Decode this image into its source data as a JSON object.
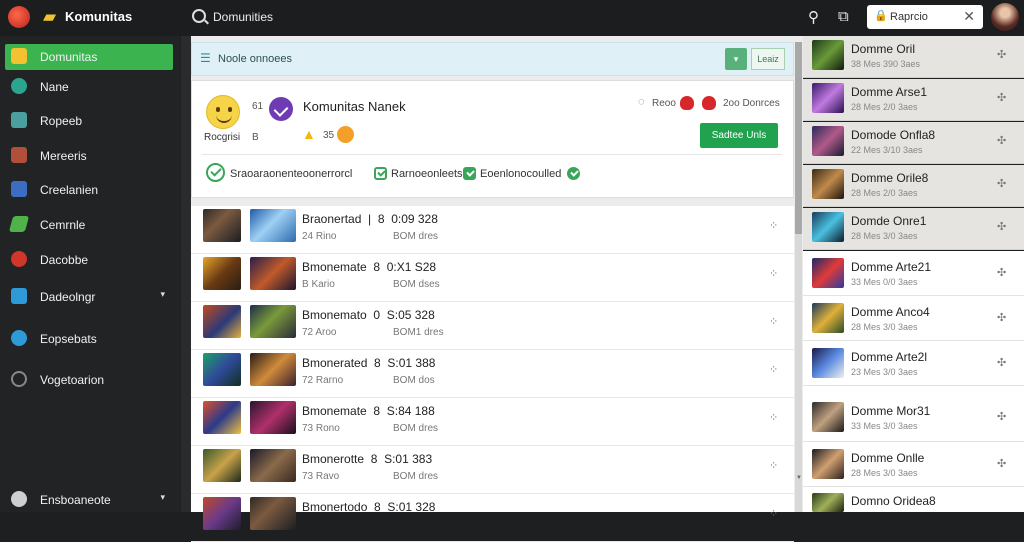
{
  "app": {
    "title": "Komunitas"
  },
  "topbar": {
    "search_text": "Domunities",
    "pill_text": "Raprcio",
    "pill_close": "✕"
  },
  "colors": {
    "accent_green": "#3bb44f",
    "join_green": "#21a24f",
    "info_bg": "#dff1f6",
    "sidebar_bg": "#222325"
  },
  "sidebar": {
    "items": [
      {
        "label": "Domunitas",
        "icon": "folder-icon",
        "active": true
      },
      {
        "label": "Nane",
        "icon": "globe-icon"
      },
      {
        "label": "Ropeeb",
        "icon": "store-icon"
      },
      {
        "label": "Mereeris",
        "icon": "gallery-icon"
      },
      {
        "label": "Creelanien",
        "icon": "puzzle-icon"
      },
      {
        "label": "Cemrnle",
        "icon": "arrow-icon"
      },
      {
        "label": "Dacobbe",
        "icon": "fire-icon"
      },
      {
        "label": "Dadeolngr",
        "icon": "window-icon",
        "chevron": "▾"
      },
      {
        "label": "Eopsebats",
        "icon": "chart-icon"
      },
      {
        "label": "Vogetoarion",
        "icon": "circle-icon"
      },
      {
        "label": "Ensboaneote",
        "icon": "plus-circle-icon",
        "chevron": "▾"
      }
    ]
  },
  "infobar": {
    "label": "Noole onnoees",
    "btn1": "▾",
    "btn2": "Leaiz"
  },
  "card": {
    "smiley_label": "Rocgrisi",
    "small_num": "61",
    "small_b": "B",
    "title": "Komunitas Nanek",
    "reaction_count": "35",
    "stats_emoji": "◌",
    "stats_n1": "Reoo",
    "stats_n2": "2oo Donrces",
    "join_label": "Sadtee Unls",
    "tags": [
      "Sraoaraonenteoonerrorcl",
      "Rarnoeonleets",
      "Eoenlonocoulled"
    ]
  },
  "list": {
    "rows": [
      {
        "name": "Braonertad",
        "sep": "8",
        "code": "0:09 328",
        "n1": "24 Rino",
        "n2": "BOM dres"
      },
      {
        "name": "Bmonemate",
        "sep": "8",
        "code": "0:X1 S28",
        "n1": "B Kario",
        "n2": "BOM dses"
      },
      {
        "name": "Bmonemato",
        "sep": "0",
        "code": "S:05 328",
        "n1": "72 Aroo",
        "n2": "BOM1 dres"
      },
      {
        "name": "Bmonerated",
        "sep": "8",
        "code": "S:01 388",
        "n1": "72 Rarno",
        "n2": "BOM dos"
      },
      {
        "name": "Bmonemate",
        "sep": "8",
        "code": "S:84 188",
        "n1": "73 Rono",
        "n2": "BOM dres"
      },
      {
        "name": "Bmonerotte",
        "sep": "8",
        "code": "S:01 383",
        "n1": "73 Ravo",
        "n2": "BOM dres"
      },
      {
        "name": "Bmonertodo",
        "sep": "8",
        "code": "S:01 328",
        "n1": "",
        "n2": ""
      }
    ]
  },
  "rpanel": {
    "rows": [
      {
        "name": "Domme Oril",
        "meta": "38 Mes 390 3aes",
        "dim": true
      },
      {
        "name": "Domme Arse1",
        "meta": "28 Mes 2/0 3aes",
        "dim": true
      },
      {
        "name": "Domode Onfla8",
        "meta": "22 Mes 3/10 3aes",
        "dim": true
      },
      {
        "name": "Domme Orile8",
        "meta": "28 Mes 2/0 3aes",
        "dim": true
      },
      {
        "name": "Domde Onre1",
        "meta": "28 Mes 3/0 3aes",
        "dim": true
      },
      {
        "name": "Domme Arte21",
        "meta": "33 Mes 0/0 3aes",
        "dim": false
      },
      {
        "name": "Domme Anco4",
        "meta": "28 Mes 3/0 3aes",
        "dim": false
      },
      {
        "name": "Domme Arte2l",
        "meta": "23 Mes 3/0 3aes",
        "dim": false
      },
      {
        "name": "Domme Mor31",
        "meta": "33 Mes 3/0 3aes",
        "dim": false
      },
      {
        "name": "Domme Onlle",
        "meta": "28 Mes 3/0 3aes",
        "dim": false
      },
      {
        "name": "Domno Oridea8",
        "meta": "",
        "dim": false
      }
    ]
  }
}
